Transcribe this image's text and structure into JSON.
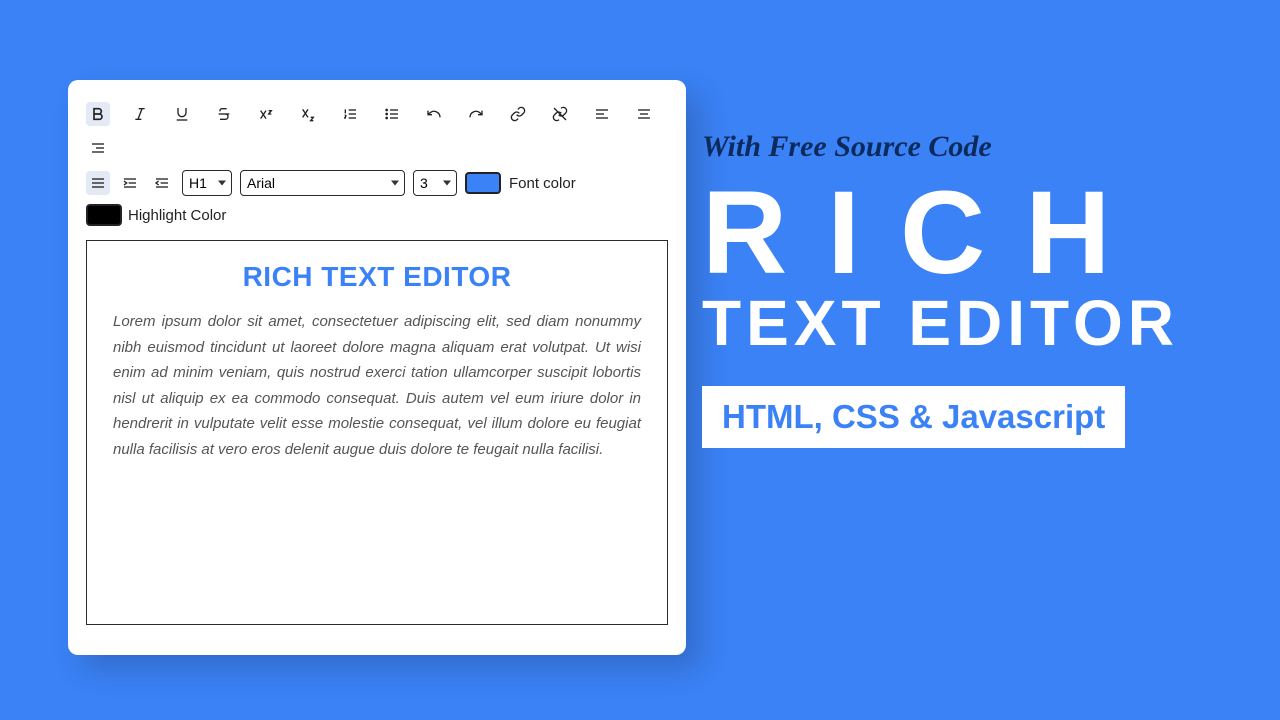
{
  "editor": {
    "heading_select": "H1",
    "font_select": "Arial",
    "size_select": "3",
    "font_color_label": "Font color",
    "highlight_color_label": "Highlight Color",
    "content_title": "RICH TEXT EDITOR",
    "content_body": "Lorem ipsum dolor sit amet, consectetuer adipiscing elit, sed diam nonummy nibh euismod tincidunt ut laoreet dolore magna aliquam erat volutpat. Ut wisi enim ad minim veniam, quis nostrud exerci tation ullamcorper suscipit lobortis nisl ut aliquip ex ea commodo consequat. Duis autem vel eum iriure dolor in hendrerit in vulputate velit esse molestie consequat, vel illum dolore eu feugiat nulla facilisis at vero eros delenit augue duis dolore te feugait nulla facilisi."
  },
  "promo": {
    "subtitle": "With Free Source Code",
    "title_line1": "RICH",
    "title_line2": "TEXT EDITOR",
    "tag": "HTML, CSS & Javascript"
  }
}
